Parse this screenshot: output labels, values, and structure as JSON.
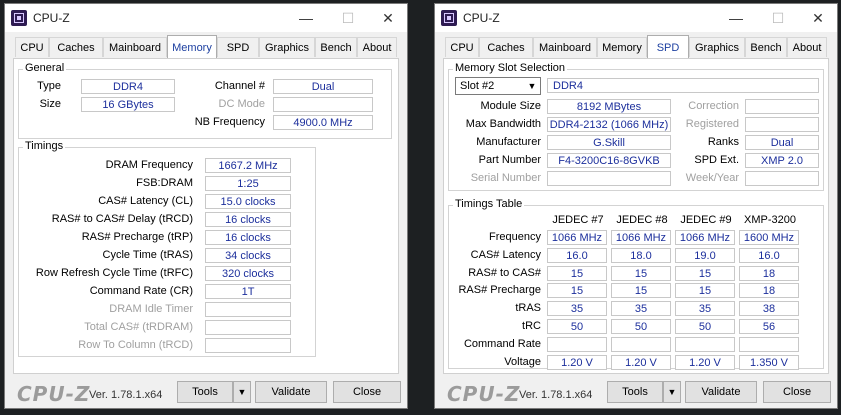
{
  "app_title": "CPU-Z",
  "window_controls": {
    "minimize": "—",
    "maximize": "☐",
    "close": "✕"
  },
  "tabs": [
    "CPU",
    "Caches",
    "Mainboard",
    "Memory",
    "SPD",
    "Graphics",
    "Bench",
    "About"
  ],
  "memory": {
    "general_title": "General",
    "type_label": "Type",
    "type_value": "DDR4",
    "size_label": "Size",
    "size_value": "16 GBytes",
    "channel_label": "Channel #",
    "channel_value": "Dual",
    "dc_mode_label": "DC Mode",
    "dc_mode_value": "",
    "nb_freq_label": "NB Frequency",
    "nb_freq_value": "4900.0 MHz",
    "timings_title": "Timings",
    "timings": [
      {
        "label": "DRAM Frequency",
        "value": "1667.2 MHz",
        "dim": false
      },
      {
        "label": "FSB:DRAM",
        "value": "1:25",
        "dim": false
      },
      {
        "label": "CAS# Latency (CL)",
        "value": "15.0 clocks",
        "dim": false
      },
      {
        "label": "RAS# to CAS# Delay (tRCD)",
        "value": "16 clocks",
        "dim": false
      },
      {
        "label": "RAS# Precharge (tRP)",
        "value": "16 clocks",
        "dim": false
      },
      {
        "label": "Cycle Time (tRAS)",
        "value": "34 clocks",
        "dim": false
      },
      {
        "label": "Row Refresh Cycle Time (tRFC)",
        "value": "320 clocks",
        "dim": false
      },
      {
        "label": "Command Rate (CR)",
        "value": "1T",
        "dim": false
      },
      {
        "label": "DRAM Idle Timer",
        "value": "",
        "dim": true
      },
      {
        "label": "Total CAS# (tRDRAM)",
        "value": "",
        "dim": true
      },
      {
        "label": "Row To Column (tRCD)",
        "value": "",
        "dim": true
      }
    ]
  },
  "spd": {
    "slot_title": "Memory Slot Selection",
    "slot_selected": "Slot #2",
    "slot_type": "DDR4",
    "module_size_label": "Module Size",
    "module_size_value": "8192 MBytes",
    "max_bw_label": "Max Bandwidth",
    "max_bw_value": "DDR4-2132 (1066 MHz)",
    "manufacturer_label": "Manufacturer",
    "manufacturer_value": "G.Skill",
    "part_label": "Part Number",
    "part_value": "F4-3200C16-8GVKB",
    "serial_label": "Serial Number",
    "serial_value": "",
    "correction_label": "Correction",
    "correction_value": "",
    "registered_label": "Registered",
    "registered_value": "",
    "ranks_label": "Ranks",
    "ranks_value": "Dual",
    "spd_ext_label": "SPD Ext.",
    "spd_ext_value": "XMP 2.0",
    "week_label": "Week/Year",
    "week_value": "",
    "timings_title": "Timings Table",
    "columns": [
      "JEDEC #7",
      "JEDEC #8",
      "JEDEC #9",
      "XMP-3200"
    ],
    "rows": [
      {
        "label": "Frequency",
        "values": [
          "1066 MHz",
          "1066 MHz",
          "1066 MHz",
          "1600 MHz"
        ]
      },
      {
        "label": "CAS# Latency",
        "values": [
          "16.0",
          "18.0",
          "19.0",
          "16.0"
        ]
      },
      {
        "label": "RAS# to CAS#",
        "values": [
          "15",
          "15",
          "15",
          "18"
        ]
      },
      {
        "label": "RAS# Precharge",
        "values": [
          "15",
          "15",
          "15",
          "18"
        ]
      },
      {
        "label": "tRAS",
        "values": [
          "35",
          "35",
          "35",
          "38"
        ]
      },
      {
        "label": "tRC",
        "values": [
          "50",
          "50",
          "50",
          "56"
        ]
      },
      {
        "label": "Command Rate",
        "values": [
          "",
          "",
          "",
          ""
        ]
      },
      {
        "label": "Voltage",
        "values": [
          "1.20 V",
          "1.20 V",
          "1.20 V",
          "1.350 V"
        ]
      }
    ]
  },
  "footer": {
    "logo": "CPU-Z",
    "version": "Ver. 1.78.1.x64",
    "tools_label": "Tools",
    "tools_arrow": "▼",
    "validate_label": "Validate",
    "close_label": "Close"
  },
  "colors": {
    "value_text": "#1c2f9c",
    "active_tab_text": "#1c3fa0",
    "background": "#1d2022"
  }
}
